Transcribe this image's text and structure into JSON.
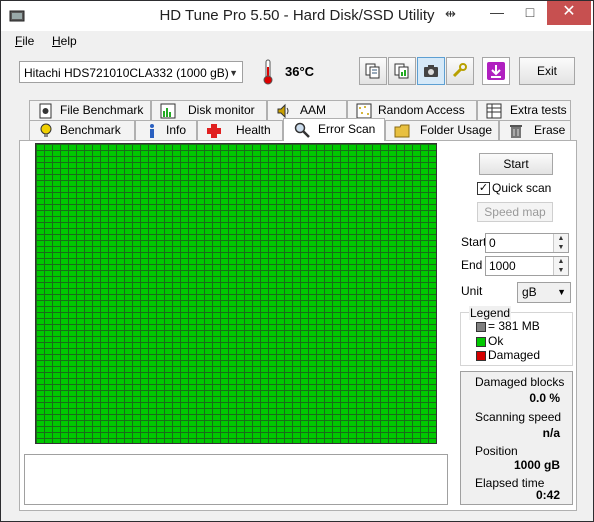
{
  "window": {
    "title": "HD Tune Pro 5.50 - Hard Disk/SSD Utility",
    "title_arrows": "⇹"
  },
  "menu": [
    {
      "prefix": "",
      "underline": "F",
      "rest": "ile"
    },
    {
      "prefix": "",
      "underline": "H",
      "rest": "elp"
    }
  ],
  "toolbar": {
    "drive": "Hitachi HDS721010CLA332 (1000 gB)",
    "temperature": "36°C",
    "exit_label": "Exit"
  },
  "tabs_top": [
    "File Benchmark",
    "Disk monitor",
    "AAM",
    "Random Access",
    "Extra tests"
  ],
  "tabs_bottom": [
    "Benchmark",
    "Info",
    "Health",
    "Error Scan",
    "Folder Usage",
    "Erase"
  ],
  "active_tab": "Error Scan",
  "controls": {
    "start_button": "Start",
    "quick_scan_label": "Quick scan",
    "quick_scan_checked": "✓",
    "speed_map_button": "Speed map",
    "start_label": "Start",
    "start_value": "0",
    "end_label": "End",
    "end_value": "1000",
    "unit_label": "Unit",
    "unit_value": "gB"
  },
  "legend": {
    "title": "Legend",
    "items": [
      {
        "label": "= 381 MB",
        "color": "#808080"
      },
      {
        "label": "Ok",
        "color": "#00c800"
      },
      {
        "label": "Damaged",
        "color": "#d40000"
      }
    ]
  },
  "stats": {
    "damaged_blocks_label": "Damaged blocks",
    "damaged_blocks_value": "0.0 %",
    "scanning_speed_label": "Scanning speed",
    "scanning_speed_value": "n/a",
    "position_label": "Position",
    "position_value": "1000 gB",
    "elapsed_label": "Elapsed time",
    "elapsed_value": "0:42"
  }
}
